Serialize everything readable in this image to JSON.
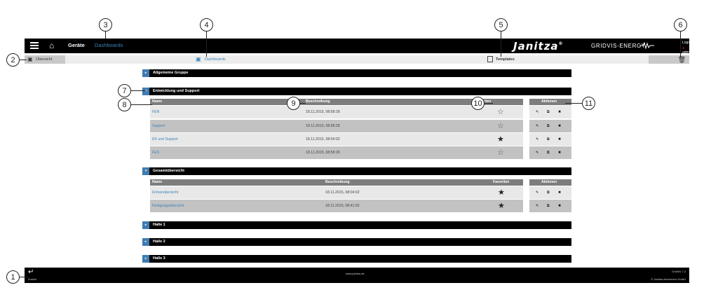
{
  "header": {
    "nav": [
      "Geräte",
      "Dashboards"
    ],
    "brand": "Janitza",
    "brand_reg": "®",
    "product": "GRIDVIS-ENERGY",
    "logout": "Logout",
    "user": "admin",
    "home_icon": "home-icon",
    "menu_icon": "hamburger-menu-icon"
  },
  "tabs": {
    "overview": "Übersicht",
    "dashboards": "Dashboards",
    "templates": "Templates"
  },
  "groups": {
    "g1": "Allgemeine Gruppe",
    "g2": "Entwicklung und Support",
    "g3": "Gesamtübersicht",
    "g4": "Halle 1",
    "g5": "Halle 2",
    "g6": "Halle 3"
  },
  "table_headers": {
    "name": "Name",
    "description": "Beschreibung",
    "favorites": "Favoriten",
    "actions": "Aktionen"
  },
  "group2_rows": [
    {
      "name": "FEN",
      "date": "18.11.2015, 08:58:28",
      "favorite": false
    },
    {
      "name": "Support",
      "date": "18.11.2015, 08:58:28",
      "favorite": false
    },
    {
      "name": "EK und Support",
      "date": "18.11.2015, 08:04:02",
      "favorite": true
    },
    {
      "name": "FES",
      "date": "18.11.2015, 08:58:28",
      "favorite": false
    }
  ],
  "group3_rows": [
    {
      "name": "Firmenübersicht",
      "date": "18.11.2015, 08:04:02",
      "favorite": true
    },
    {
      "name": "Fertigungsübersicht",
      "date": "18.11.2015, 08:41:02",
      "favorite": true
    }
  ],
  "footer": {
    "back": "Zurück",
    "url": "www.janitza.de",
    "version": "GridVis 7.2",
    "copyright": "© Janitza electronics GmbH"
  },
  "callouts": [
    "1",
    "2",
    "3",
    "4",
    "5",
    "6",
    "7",
    "8",
    "9",
    "10",
    "11"
  ],
  "colors": {
    "accent_blue": "#3b83b8",
    "toggle_blue": "#3e7cb1",
    "delete_red": "#d41e1e",
    "header_bg": "#000000"
  }
}
